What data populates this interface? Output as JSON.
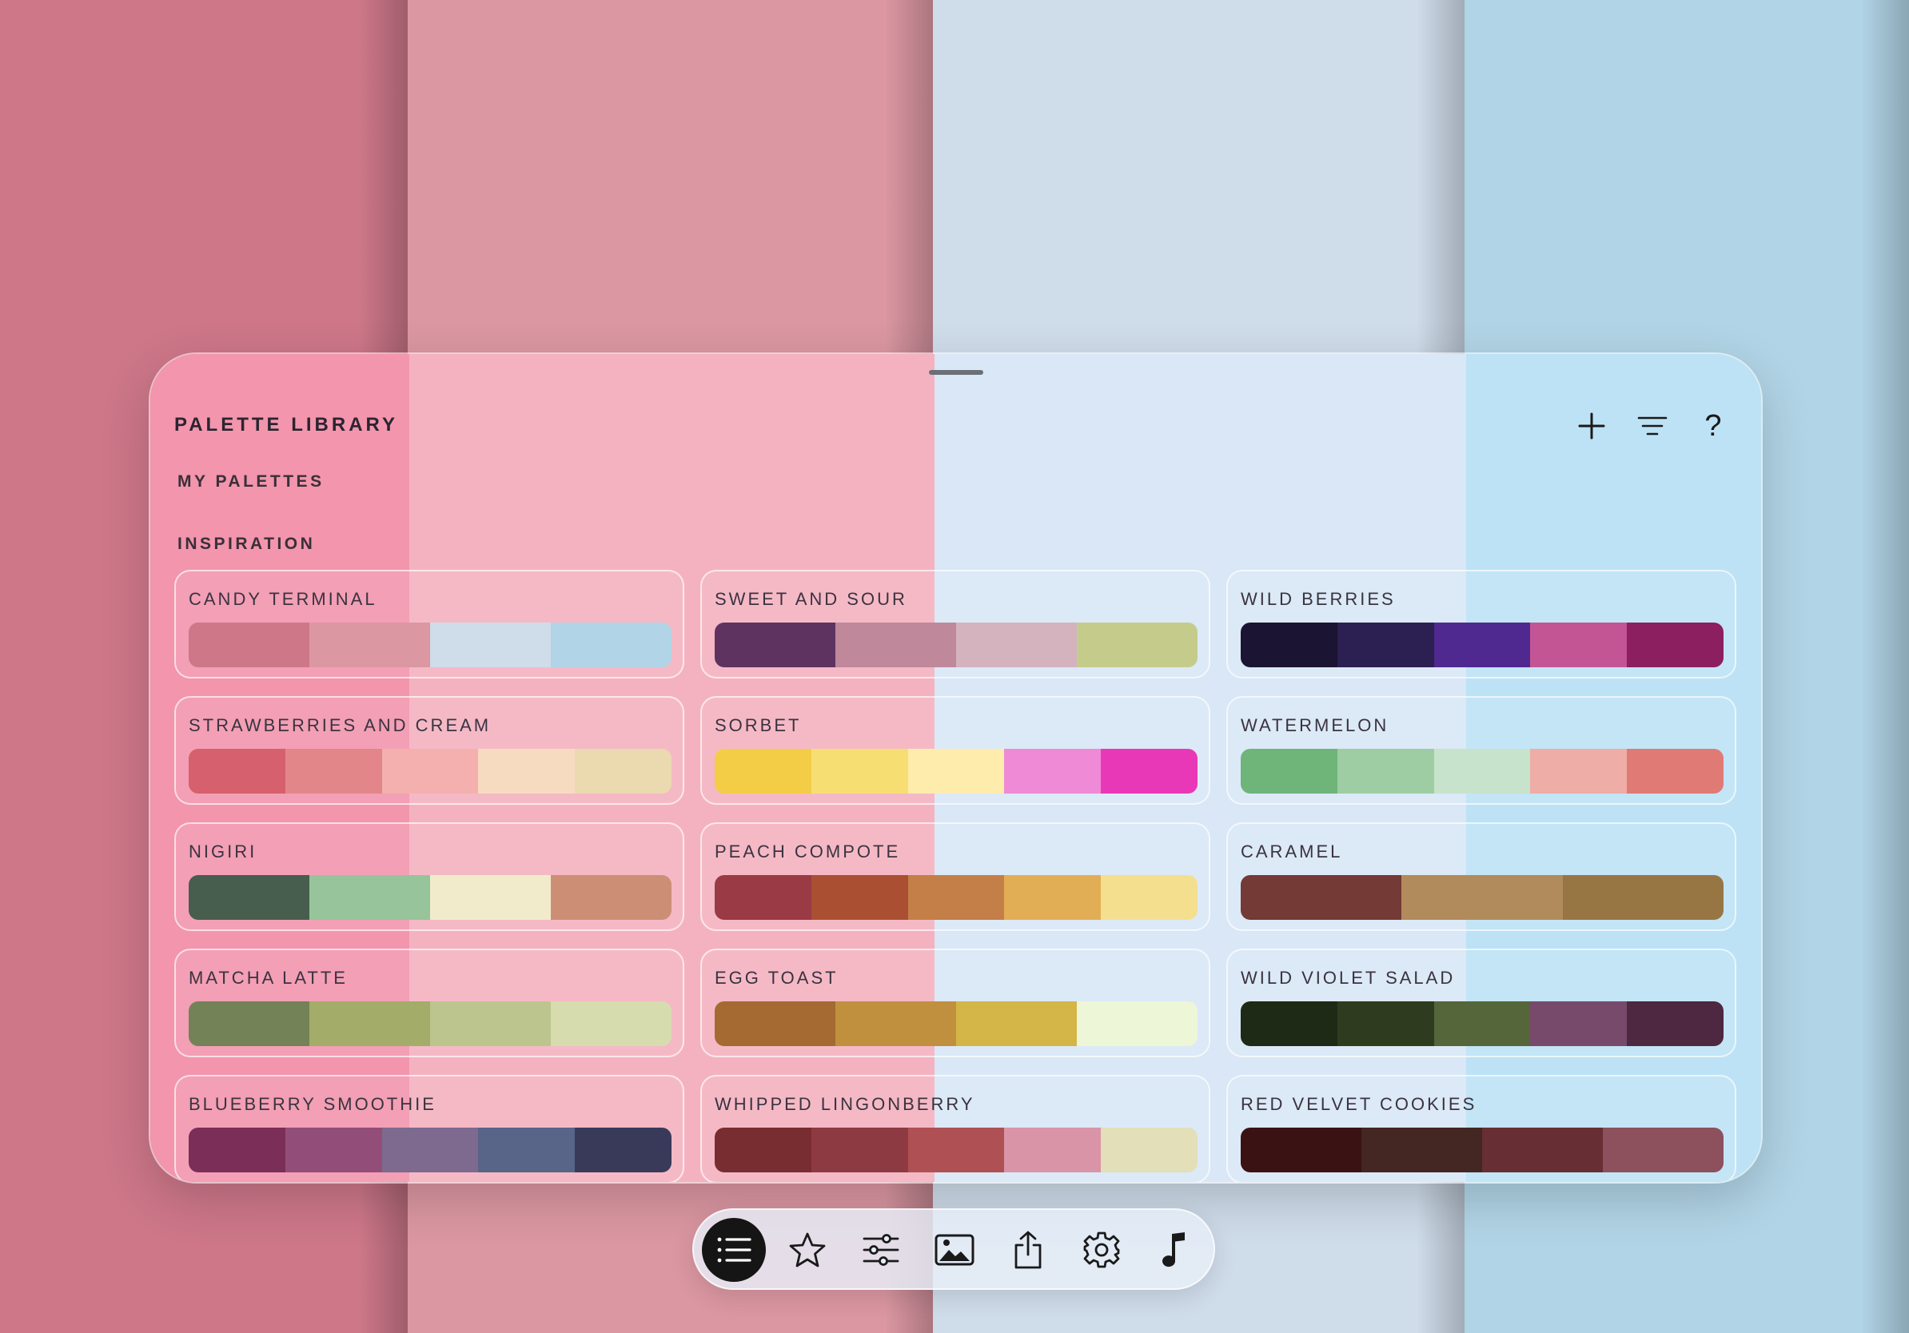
{
  "background": {
    "stripes": [
      {
        "color": "#cd7789"
      },
      {
        "color": "#db97a2"
      },
      {
        "color": "#cfdcea"
      },
      {
        "color": "#b1d4e6"
      }
    ]
  },
  "header": {
    "title": "PALETTE LIBRARY",
    "actions": [
      {
        "name": "add-icon"
      },
      {
        "name": "filter-icon"
      },
      {
        "name": "help-icon",
        "label": "?"
      }
    ]
  },
  "sections": {
    "my_palettes": "MY PALETTES",
    "inspiration": "INSPIRATION"
  },
  "palettes": [
    {
      "name": "CANDY TERMINAL",
      "colors": [
        "#cd7789",
        "#db97a2",
        "#cfdcea",
        "#b1d4e6"
      ]
    },
    {
      "name": "SWEET AND SOUR",
      "colors": [
        "#5e3360",
        "#bf889b",
        "#d4b3bf",
        "#c5cc8b"
      ]
    },
    {
      "name": "WILD BERRIES",
      "colors": [
        "#1b1432",
        "#2c1f52",
        "#4f2990",
        "#c35595",
        "#8c1f5f"
      ]
    },
    {
      "name": "STRAWBERRIES AND CREAM",
      "colors": [
        "#d6606d",
        "#e2868a",
        "#f3b0ae",
        "#f6dbc0",
        "#ebd9b0"
      ]
    },
    {
      "name": "SORBET",
      "colors": [
        "#f4cd46",
        "#f6de72",
        "#fdecac",
        "#ee8ad6",
        "#e938b7"
      ]
    },
    {
      "name": "WATERMELON",
      "colors": [
        "#6fb479",
        "#9ecda3",
        "#c8e3cb",
        "#eeada6",
        "#e07a74"
      ]
    },
    {
      "name": "NIGIRI",
      "colors": [
        "#475d4e",
        "#97c49a",
        "#f1ebcb",
        "#cd8e76"
      ]
    },
    {
      "name": "PEACH COMPOTE",
      "colors": [
        "#9a3a45",
        "#aa4f31",
        "#c47f48",
        "#e2ae55",
        "#f4df8f"
      ]
    },
    {
      "name": "CARAMEL",
      "colors": [
        "#733a36",
        "#b28b5c",
        "#987644"
      ]
    },
    {
      "name": "MATCHA LATTE",
      "colors": [
        "#738257",
        "#a3ad69",
        "#bdc58f",
        "#d7dcaf"
      ]
    },
    {
      "name": "EGG TOAST",
      "colors": [
        "#a46a32",
        "#c1903f",
        "#d4b548",
        "#eef6d8"
      ]
    },
    {
      "name": "WILD VIOLET SALAD",
      "colors": [
        "#1e2916",
        "#2f3b1e",
        "#54663a",
        "#774a6c",
        "#4e2740"
      ]
    },
    {
      "name": "BLUEBERRY SMOOTHIE",
      "colors": [
        "#7a2e58",
        "#924e78",
        "#7d6a8e",
        "#586488",
        "#393a5a"
      ]
    },
    {
      "name": "WHIPPED LINGONBERRY",
      "colors": [
        "#782d31",
        "#8d3a43",
        "#af5055",
        "#da94a7",
        "#e3dfb8"
      ]
    },
    {
      "name": "RED VELVET COOKIES",
      "colors": [
        "#3b1213",
        "#442622",
        "#672e34",
        "#8d505d"
      ]
    }
  ],
  "toolbar": {
    "items": [
      {
        "name": "list-icon",
        "active": true
      },
      {
        "name": "star-icon",
        "active": false
      },
      {
        "name": "sliders-icon",
        "active": false
      },
      {
        "name": "image-icon",
        "active": false
      },
      {
        "name": "share-icon",
        "active": false
      },
      {
        "name": "gear-icon",
        "active": false
      },
      {
        "name": "music-note-icon",
        "active": false
      }
    ]
  }
}
